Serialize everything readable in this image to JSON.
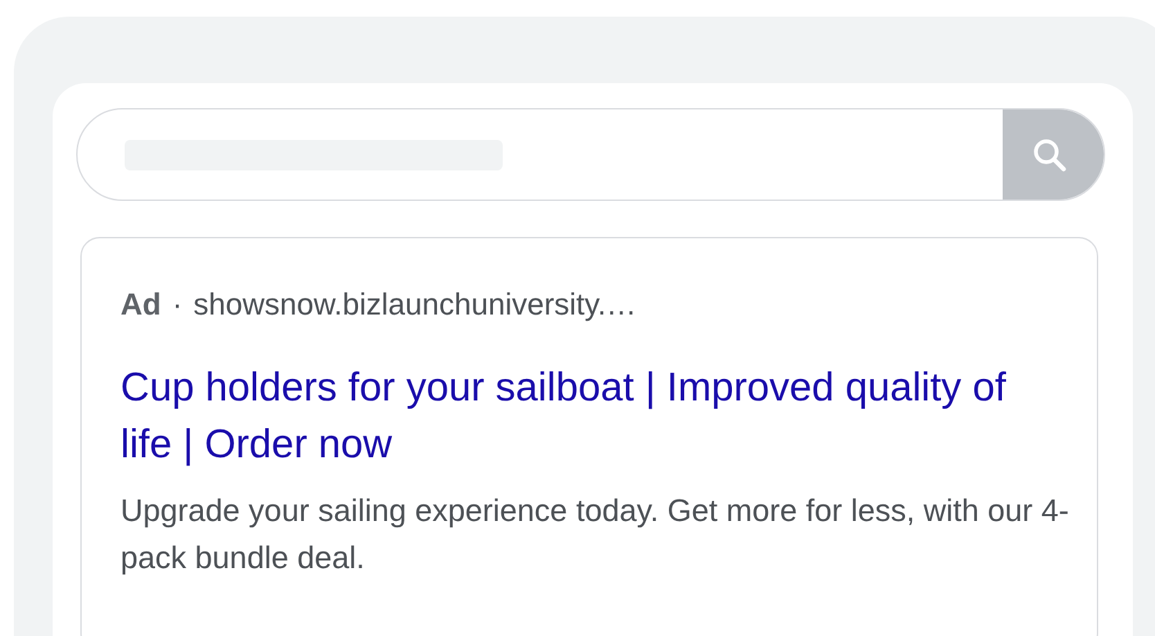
{
  "ad": {
    "label": "Ad",
    "separator": "·",
    "url": "showsnow.bizlaunchuniversity.…",
    "title": "Cup holders for your sailboat | Improved quality of life | Order now",
    "description": "Upgrade your sailing experience today. Get more for less, with our 4-pack bundle deal."
  }
}
